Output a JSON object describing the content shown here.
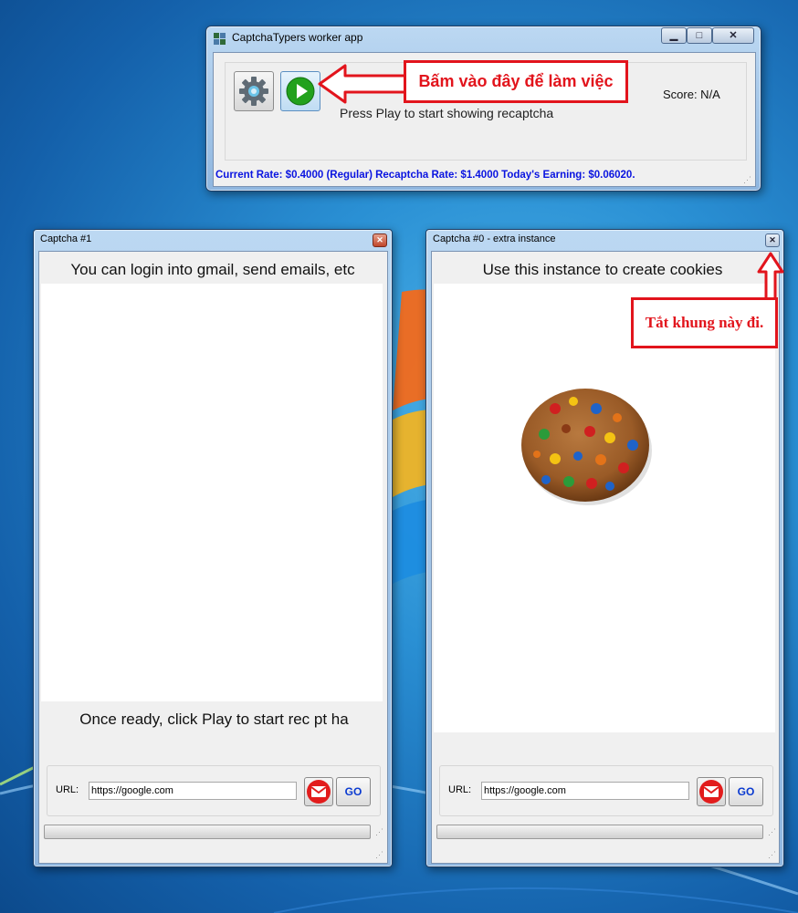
{
  "main_window": {
    "title": "CaptchaTypers worker app",
    "status_text": "Press Play to start showing recaptcha",
    "score": "Score: N/A",
    "rates": "Current Rate: $0.4000 (Regular) Recaptcha Rate: $1.4000 Today's Earning: $0.06020.",
    "callout": "Bấm vào đây để làm việc"
  },
  "captcha1": {
    "title": "Captcha #1",
    "heading": "You can login into gmail, send emails, etc",
    "footer_text": "Once ready, click Play to start rec  pt ha",
    "url_label": "URL:",
    "url_value": "https://google.com",
    "go_label": "GO"
  },
  "captcha0": {
    "title": "Captcha #0 - extra instance",
    "heading": "Use this instance to create cookies",
    "callout": "Tắt khung này đi.",
    "url_label": "URL:",
    "url_value": "https://google.com",
    "go_label": "GO"
  },
  "colors": {
    "callout_red": "#e2141c",
    "rate_blue": "#0a14e0",
    "play_green": "#22a11c"
  },
  "icons": [
    "gear-icon",
    "play-icon",
    "gmail-icon",
    "minimize-icon",
    "maximize-icon",
    "close-icon",
    "resize-grip-icon",
    "app-logo-icon",
    "cookie-image",
    "red-arrow-icon"
  ]
}
